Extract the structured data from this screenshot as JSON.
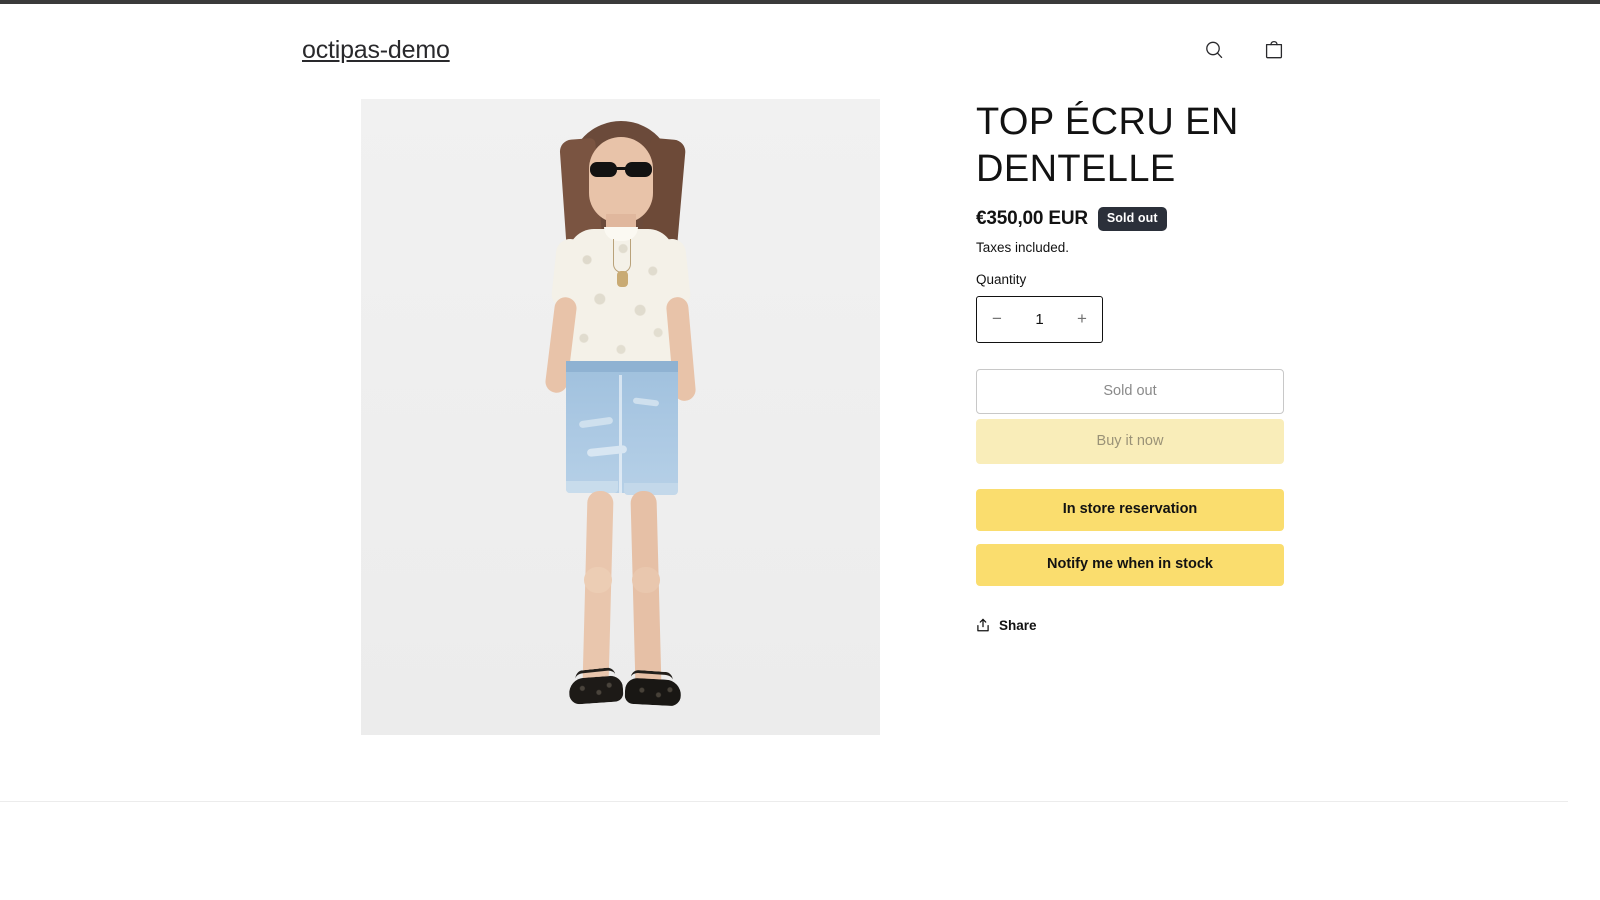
{
  "header": {
    "shop_title": "octipas-demo",
    "search_icon": "search-icon",
    "cart_icon": "shopping-bag-icon"
  },
  "media": {
    "alt": "Model wearing cream lace top with denim shorts",
    "background_color": "#f0f0f0"
  },
  "product": {
    "title": "TOP ÉCRU EN DENTELLE",
    "price": "€350,00 EUR",
    "availability_badge": "Sold out",
    "taxes_note": "Taxes included.",
    "quantity": {
      "label": "Quantity",
      "decrease_label": "−",
      "value": "1",
      "increase_label": "+"
    },
    "buttons": {
      "sold_out": "Sold out",
      "buy_it_now": "Buy it now",
      "in_store_reservation": "In store reservation",
      "notify_me": "Notify me when in stock"
    },
    "share": {
      "label": "Share",
      "icon": "share-icon"
    }
  },
  "colors": {
    "accent_yellow": "#fadd6e",
    "accent_yellow_pale": "#f9edb9",
    "badge_dark": "#2b303a",
    "text_primary": "#121212",
    "top_strip": "#3a3a3a"
  }
}
